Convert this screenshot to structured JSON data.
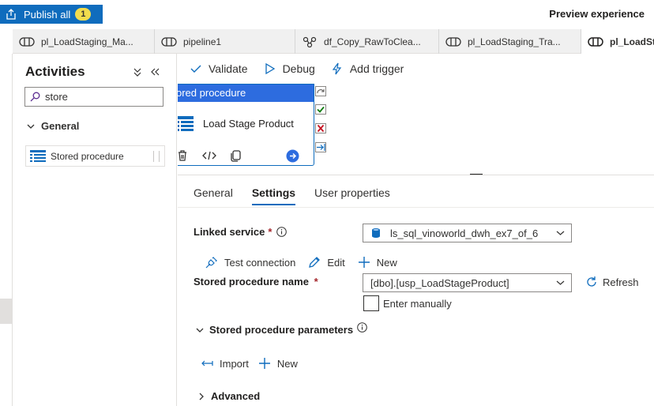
{
  "topbar": {
    "publish_label": "Publish all",
    "publish_count": "1",
    "preview_label": "Preview experience"
  },
  "tabs": [
    {
      "label": "pl_LoadStaging_Ma...",
      "icon": "pipeline-icon"
    },
    {
      "label": "pipeline1",
      "icon": "pipeline-icon"
    },
    {
      "label": "df_Copy_RawToClea...",
      "icon": "dataflow-icon"
    },
    {
      "label": "pl_LoadStaging_Tra...",
      "icon": "pipeline-icon"
    },
    {
      "label": "pl_LoadSt",
      "icon": "pipeline-icon"
    }
  ],
  "activities": {
    "title": "Activities",
    "search_value": "store",
    "group_label": "General",
    "item_label": "Stored procedure"
  },
  "toolbar": {
    "validate_label": "Validate",
    "debug_label": "Debug",
    "trigger_label": "Add trigger"
  },
  "node": {
    "header": "ored procedure",
    "name": "Load Stage Product"
  },
  "property_tabs": [
    {
      "label": "General"
    },
    {
      "label": "Settings",
      "active": true
    },
    {
      "label": "User properties"
    }
  ],
  "settings": {
    "linked_service_label": "Linked service",
    "required_mark": "*",
    "linked_service_value": "ls_sql_vinoworld_dwh_ex7_of_6",
    "test_connection_label": "Test connection",
    "edit_label": "Edit",
    "new_label": "New",
    "sp_name_label": "Stored procedure name",
    "sp_name_value": "[dbo].[usp_LoadStageProduct]",
    "refresh_label": "Refresh",
    "enter_manually_label": "Enter manually",
    "params_section_label": "Stored procedure parameters",
    "import_label": "Import",
    "params_new_label": "New",
    "advanced_label": "Advanced"
  },
  "colors": {
    "accent": "#0f6cbd",
    "node_header": "#2d6cdf",
    "badge": "#f2dc4d",
    "success": "#107c10",
    "error": "#c50f1f"
  }
}
